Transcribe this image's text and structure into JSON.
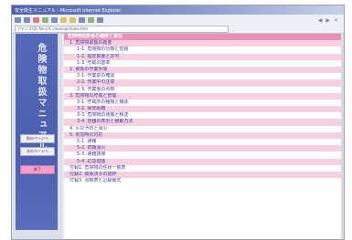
{
  "window": {
    "title": "安全衛生マニュアル - Microsoft Internet Explorer"
  },
  "toolbar": {
    "address": "アドレス(D)  file:///C:/manual/index.htm",
    "right_icons": [
      "back-icon",
      "forward-icon",
      "close-icon"
    ],
    "right_glyphs": [
      "◀",
      "▶",
      "✕"
    ]
  },
  "sidebar": {
    "title": "危険物取扱マニュアル",
    "buttons": [
      {
        "label": "前のページへ",
        "color": "#eef0f8"
      },
      {
        "label": "次のページへ",
        "color": "#eef0f8"
      },
      {
        "label": "終了",
        "color": "#f0a0c8"
      }
    ]
  },
  "content": {
    "rows": [
      {
        "text": "危険物取扱者の義務と責任",
        "style": "head"
      },
      {
        "text": "1. 危険物取扱の概要",
        "style": "pink"
      },
      {
        "text": "1-1. 危険物の分類と性質",
        "style": "white"
      },
      {
        "text": "1-2. 指定数量と許可",
        "style": "pink"
      },
      {
        "text": "1-3. 貯蔵の基準",
        "style": "white"
      },
      {
        "text": "2. 取扱の作業手順",
        "style": "pink"
      },
      {
        "text": "2-1. 作業前の確認",
        "style": "white"
      },
      {
        "text": "2-2. 作業中の注意",
        "style": "pink"
      },
      {
        "text": "2-3. 作業後の点検",
        "style": "white"
      },
      {
        "text": "3. 危険物の貯蔵と管理",
        "style": "pink"
      },
      {
        "text": "3-1. 貯蔵所の種類と構造",
        "style": "white"
      },
      {
        "text": "3-2. 保安距離",
        "style": "pink"
      },
      {
        "text": "3-3. 危険物の運搬と移送",
        "style": "white"
      },
      {
        "text": "3-4. 容器の表示と積載方法",
        "style": "pink"
      },
      {
        "text": "4. 火災予防と消火",
        "style": "white"
      },
      {
        "text": "5. 緊急時の対応",
        "style": "pink"
      },
      {
        "text": "5-1. 通報",
        "style": "white"
      },
      {
        "text": "5-2. 初期消火",
        "style": "pink"
      },
      {
        "text": "5-3. 避難誘導",
        "style": "white"
      },
      {
        "text": "5-4. 応急措置",
        "style": "pink"
      },
      {
        "text": "付録1. 危険物の性状一覧表",
        "style": "white"
      },
      {
        "text": "付録2. 関係法令の抜粋",
        "style": "pink"
      },
      {
        "text": "付録3. 点検表と記録様式",
        "style": "white"
      }
    ],
    "selected_index": 0
  }
}
